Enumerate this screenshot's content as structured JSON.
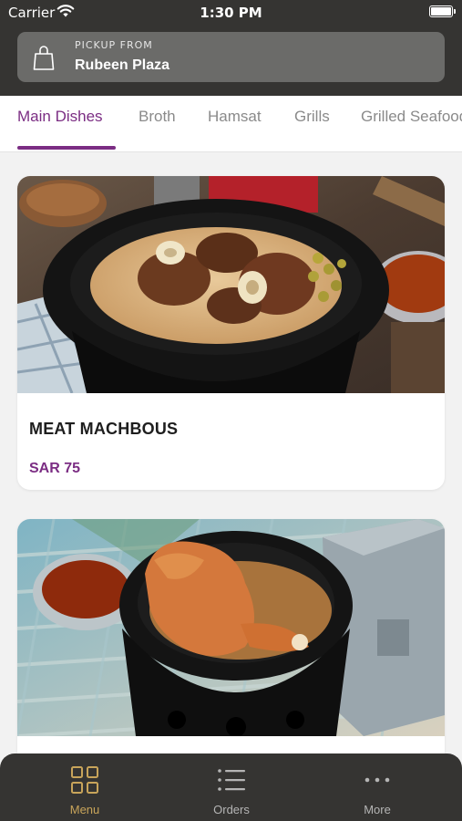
{
  "status_bar": {
    "carrier": "Carrier",
    "time": "1:30 PM"
  },
  "pickup": {
    "label": "PICKUP FROM",
    "location": "Rubeen Plaza",
    "icon": "shopping-bag-icon"
  },
  "tabs": [
    {
      "label": "Main Dishes",
      "active": true
    },
    {
      "label": "Broth",
      "active": false
    },
    {
      "label": "Hamsat",
      "active": false
    },
    {
      "label": "Grills",
      "active": false
    },
    {
      "label": "Grilled Seafood",
      "active": false
    }
  ],
  "menu_items": [
    {
      "name": "MEAT MACHBOUS",
      "price": "SAR 75"
    },
    {
      "name": "",
      "price": ""
    }
  ],
  "bottom_nav": [
    {
      "label": "Menu",
      "icon": "grid-icon",
      "active": true
    },
    {
      "label": "Orders",
      "icon": "list-icon",
      "active": false
    },
    {
      "label": "More",
      "icon": "more-dots-icon",
      "active": false
    }
  ],
  "colors": {
    "accent": "#7b2d83",
    "header_bg": "#353432",
    "nav_active": "#c8a45a",
    "nav_inactive": "#b5b5b5"
  }
}
